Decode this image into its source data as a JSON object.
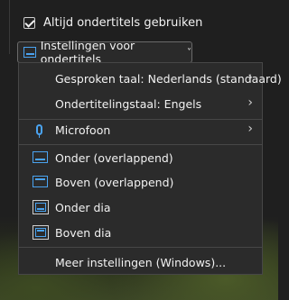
{
  "checkbox": {
    "label": "Altijd ondertitels gebruiken",
    "checked": true
  },
  "settings_button": {
    "label": "Instellingen voor ondertitels",
    "caret": "˅"
  },
  "menu": {
    "spoken_language": "Gesproken taal: Nederlands (standaard)",
    "subtitle_language": "Ondertitelingstaal: Engels",
    "microphone": "Microfoon",
    "position_options": [
      "Onder (overlappend)",
      "Boven (overlappend)",
      "Onder dia",
      "Boven dia"
    ],
    "more_settings": "Meer instellingen (Windows)..."
  },
  "colors": {
    "accent": "#4aa3f0",
    "menu_bg": "#2b2b2b",
    "text": "#f2f2f2"
  }
}
